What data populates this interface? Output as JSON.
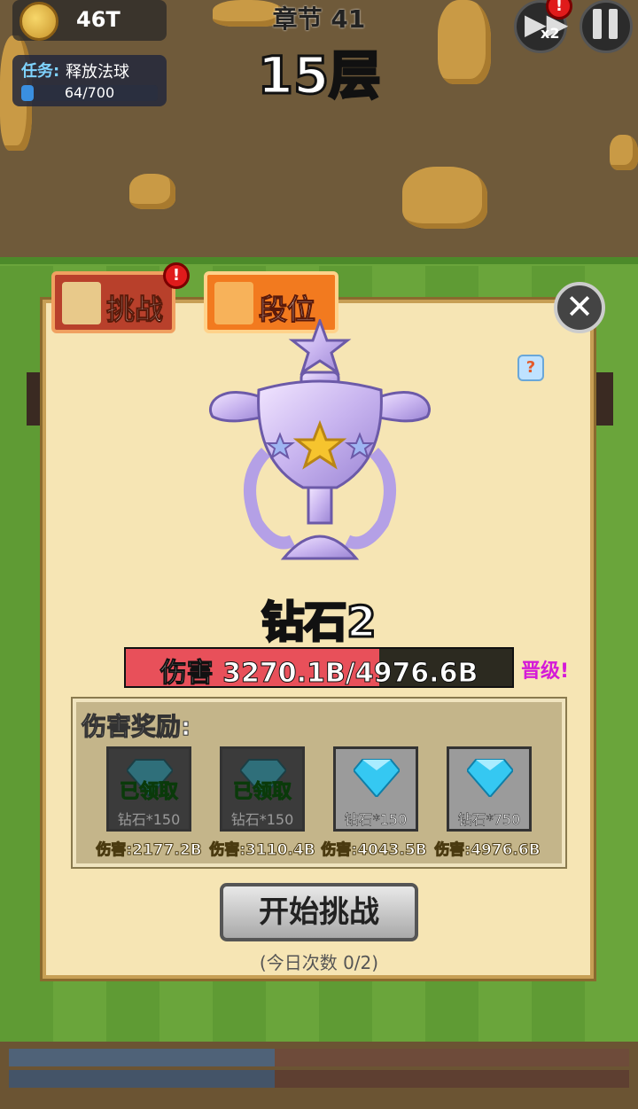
{
  "hud": {
    "coins": "46T",
    "task": {
      "label": "任务:",
      "name": "释放法球",
      "progress": "64/700",
      "fraction": 0.09
    },
    "chapter": "章节 41",
    "floor": "15层",
    "speed_label": "x2",
    "speed_alert": "!"
  },
  "dialog": {
    "tabs": [
      {
        "label": "挑战",
        "alert": "!"
      },
      {
        "label": "段位"
      }
    ],
    "close_glyph": "✕",
    "help_glyph": "?",
    "rank_name": "钻石2",
    "damage": {
      "text": "伤害 3270.1B/4976.6B",
      "fraction": 0.657
    },
    "promote_label": "晋级!",
    "rewards_title": "伤害奖励:",
    "rewards": [
      {
        "label": "钻石*150",
        "state_text": "已领取",
        "damage": "伤害:2177.2B"
      },
      {
        "label": "钻石*150",
        "state_text": "已领取",
        "damage": "伤害:3110.4B"
      },
      {
        "label": "钻石*150",
        "damage": "伤害:4043.5B"
      },
      {
        "label": "钻石*750",
        "damage": "伤害:4976.6B"
      }
    ],
    "start_button": "开始挑战",
    "daily_count": "(今日次数 0/2)"
  },
  "colors": {
    "gem": "#35c8f2",
    "damage_fill": "#e8505a",
    "promote": "#d51ad8",
    "claimed": "#4bd63a"
  }
}
